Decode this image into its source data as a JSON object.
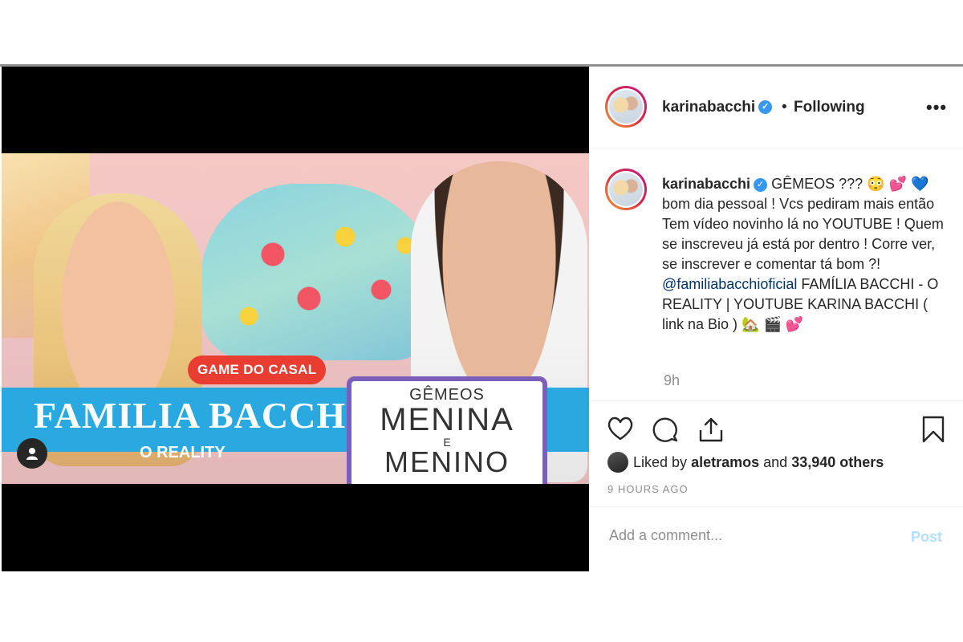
{
  "media": {
    "game_tag": "GAME DO CASAL",
    "title": "FAMILIA BACCHI",
    "subtitle": "O REALITY",
    "board_line1": "GÊMEOS",
    "board_line2": "MENINA",
    "board_line3": "E",
    "board_line4": "MENINO",
    "tag_user_icon": "user-icon"
  },
  "header": {
    "username": "karinabacchi",
    "separator": "•",
    "follow_status": "Following",
    "more": "•••"
  },
  "caption": {
    "username": "karinabacchi",
    "text_1": " GÊMEOS ??? 😳 💕 💙 bom dia pessoal ! Vcs pediram mais então Tem vídeo novinho lá no YOUTUBE ! Quem se inscreveu já está por dentro ! Corre ver, se inscrever e comentar tá bom ?! ",
    "mention": "@familiabacchioficial",
    "text_2": " FAMÍLIA BACCHI - O REALITY | YOUTUBE KARINA BACCHI ( link na Bio ) 🏡 🎬 💕",
    "relative_time": "9h"
  },
  "actions": {
    "icons": [
      "heart-icon",
      "comment-icon",
      "share-icon",
      "bookmark-icon"
    ]
  },
  "likes": {
    "prefix": "Liked by ",
    "user": "aletramos",
    "middle": " and ",
    "others": "33,940 others"
  },
  "timestamp": "9 HOURS AGO",
  "comment": {
    "placeholder": "Add a comment...",
    "post_label": "Post"
  },
  "colors": {
    "accent_blue": "#3897f0",
    "mention": "#003569",
    "post_disabled": "#b2dffc",
    "banner": "#2aa9e0",
    "game_tag": "#ea3d31"
  }
}
